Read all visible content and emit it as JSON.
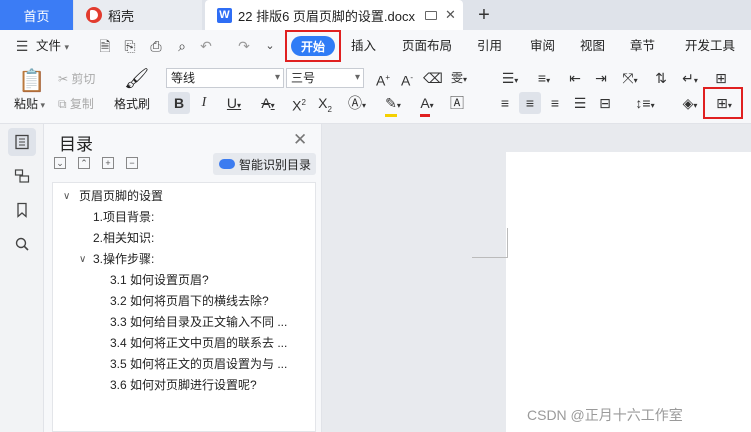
{
  "tabs": {
    "home": "首页",
    "daoke": "稻壳",
    "doc": "22 排版6 页眉页脚的设置.docx",
    "doc_badge": "W",
    "add": "+"
  },
  "menu": {
    "file": "文件",
    "items": [
      "开始",
      "插入",
      "页面布局",
      "引用",
      "审阅",
      "视图",
      "章节",
      "开发工具"
    ]
  },
  "ribbon": {
    "paste": "粘贴",
    "cut": "剪切",
    "copy": "复制",
    "format_painter": "格式刷",
    "font_name": "等线",
    "font_size": "三号"
  },
  "toc": {
    "title": "目录",
    "smart_button": "智能识别目录",
    "items": [
      "页眉页脚的设置",
      "1.项目背景:",
      "2.相关知识:",
      "3.操作步骤:",
      "3.1 如何设置页眉?",
      "3.2 如何将页眉下的横线去除?",
      "3.3 如何给目录及正文输入不同 ...",
      "3.4 如何将正文中页眉的联系去 ...",
      "3.5 如何将正文的页眉设置为与 ...",
      "3.6 如何对页脚进行设置呢?"
    ]
  },
  "watermark": "CSDN @正月十六工作室",
  "colors": {
    "accent": "#2f7cf6",
    "highlight_box": "#e02020",
    "tab_home": "#3b7cf5"
  }
}
